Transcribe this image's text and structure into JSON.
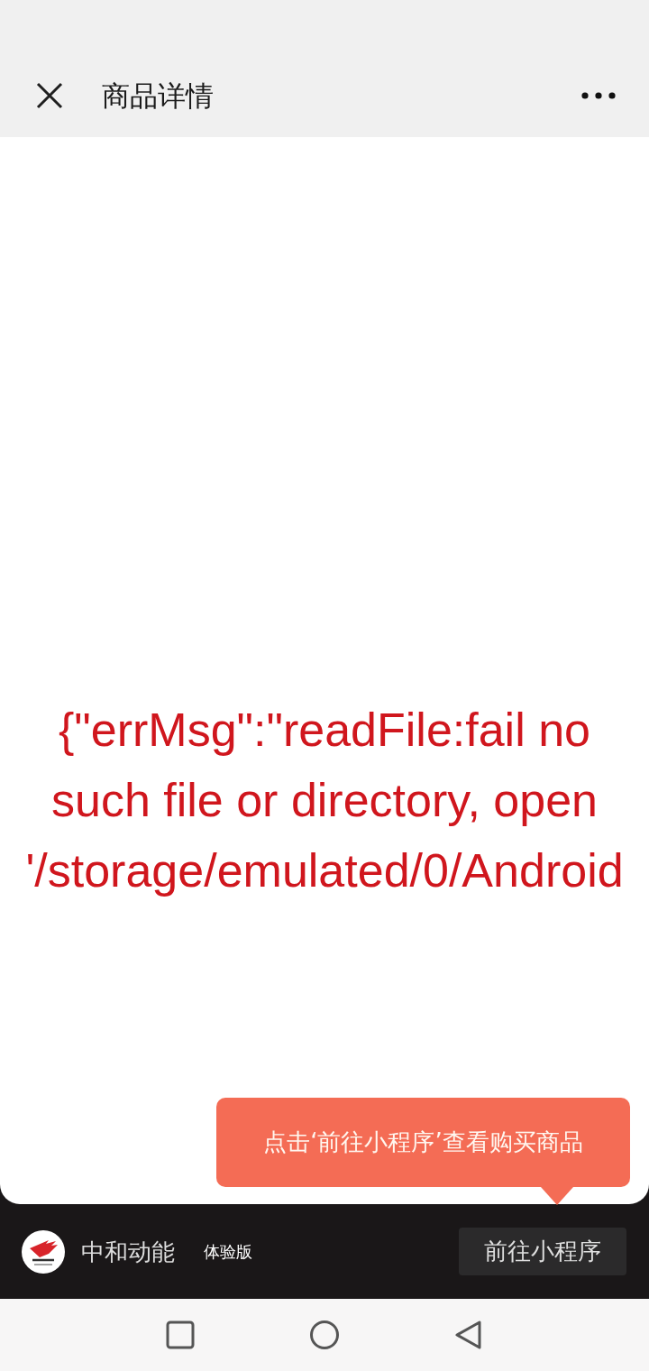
{
  "nav_bar": {
    "title": "商品详情"
  },
  "error_message": "{\"errMsg\":\"readFile:fail no\nsuch file or directory, open\n'/storage/emulated/0/Android",
  "tooltip": {
    "text": "点击‘前往小程序’查看购买商品"
  },
  "mini_program_bar": {
    "name": "中和动能",
    "badge": "体验版",
    "button": "前往小程序"
  }
}
